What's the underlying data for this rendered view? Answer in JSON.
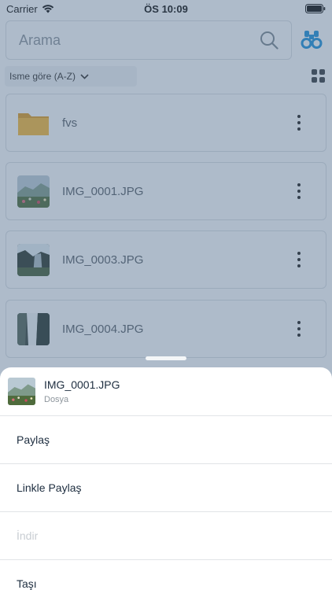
{
  "status_bar": {
    "carrier": "Carrier",
    "time": "ÖS 10:09"
  },
  "search": {
    "placeholder": "Arama"
  },
  "sort": {
    "label": "Isme göre (A-Z)"
  },
  "files": [
    {
      "name": "fvs",
      "type": "folder"
    },
    {
      "name": "IMG_0001.JPG",
      "type": "image"
    },
    {
      "name": "IMG_0003.JPG",
      "type": "image"
    },
    {
      "name": "IMG_0004.JPG",
      "type": "image"
    }
  ],
  "sheet": {
    "file_name": "IMG_0001.JPG",
    "file_type": "Dosya",
    "actions": [
      {
        "label": "Paylaş",
        "enabled": true
      },
      {
        "label": "Linkle Paylaş",
        "enabled": true
      },
      {
        "label": "İndir",
        "enabled": false
      },
      {
        "label": "Taşı",
        "enabled": true
      }
    ]
  },
  "colors": {
    "accent": "#1f8fd6",
    "overlay": "#4c6a8a",
    "folder": "#f0b63c"
  },
  "icons": [
    "wifi-icon",
    "battery-icon",
    "search-icon",
    "binoculars-icon",
    "chevron-down-icon",
    "grid-view-icon",
    "folder-icon",
    "more-vertical-icon"
  ]
}
